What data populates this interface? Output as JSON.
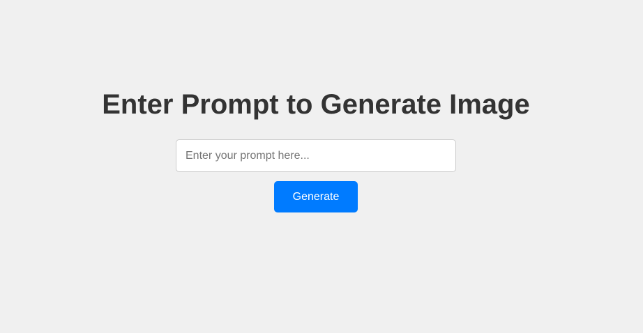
{
  "page": {
    "heading": "Enter Prompt to Generate Image"
  },
  "prompt": {
    "value": "",
    "placeholder": "Enter your prompt here..."
  },
  "actions": {
    "generate_label": "Generate"
  },
  "colors": {
    "background": "#f0f0f0",
    "heading_text": "#333333",
    "button_bg": "#007bff",
    "button_text": "#ffffff",
    "input_border": "#cccccc"
  }
}
